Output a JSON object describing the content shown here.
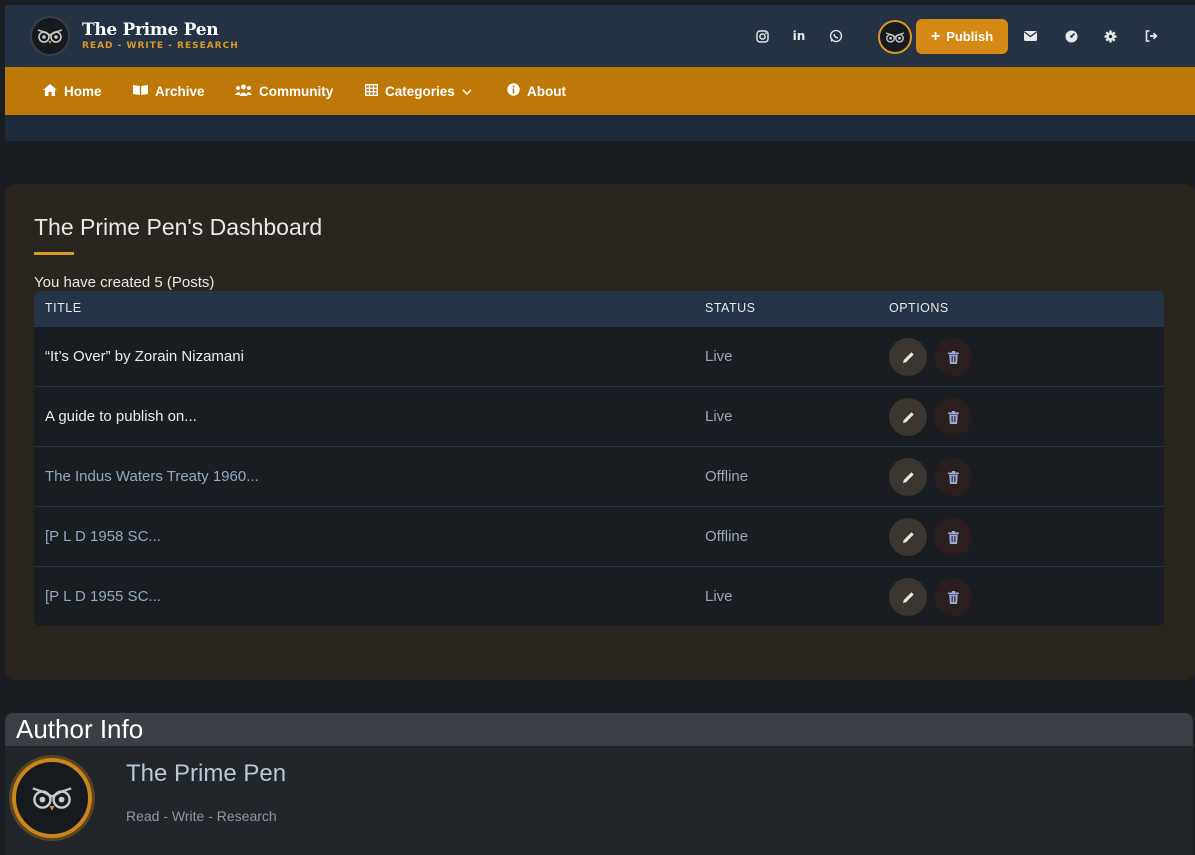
{
  "header": {
    "brand_title": "The Prime Pen",
    "brand_tagline": "READ - WRITE - RESEARCH",
    "social": [
      "instagram-icon",
      "linkedin-icon",
      "whatsapp-icon"
    ],
    "linkedin_text": "in",
    "publish_label": "Publish",
    "actions": [
      "mail-icon",
      "dashboard-icon",
      "settings-icon",
      "logout-icon"
    ]
  },
  "nav": {
    "home": "Home",
    "archive": "Archive",
    "community": "Community",
    "categories": "Categories",
    "about": "About"
  },
  "dashboard": {
    "title": "The Prime Pen's Dashboard",
    "count_text": "You have created 5 (Posts)",
    "columns": {
      "title": "TITLE",
      "status": "STATUS",
      "options": "OPTIONS"
    },
    "rows": [
      {
        "title": "“It’s Over” by Zorain Nizamani",
        "status": "Live"
      },
      {
        "title": "A guide to publish on...",
        "status": "Live"
      },
      {
        "title": "The Indus Waters Treaty 1960...",
        "status": "Offline"
      },
      {
        "title": "[P L D 1958 SC...",
        "status": "Offline"
      },
      {
        "title": "[P L D 1955 SC...",
        "status": "Live"
      }
    ]
  },
  "author": {
    "heading": "Author Info",
    "name": "The Prime Pen",
    "tagline": "Read - Write - Research"
  },
  "colors": {
    "accent": "#d89a26",
    "nav_bg": "#bd7808",
    "topbar_bg": "#243244",
    "page_bg": "#1a1d21",
    "panel_bg": "#2a251f"
  }
}
